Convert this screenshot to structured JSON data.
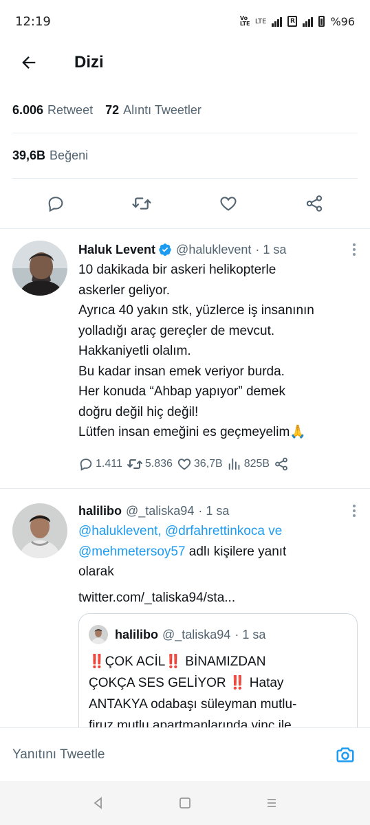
{
  "status_bar": {
    "time": "12:19",
    "volte": "Vo LTE",
    "network": "LTE",
    "battery": "%96"
  },
  "header": {
    "title": "Dizi"
  },
  "stats": {
    "retweet_count": "6.006",
    "retweet_label": "Retweet",
    "quote_count": "72",
    "quote_label": "Alıntı Tweetler",
    "like_count": "39,6B",
    "like_label": "Beğeni"
  },
  "tweets": [
    {
      "name": "Haluk Levent",
      "handle": "@haluklevent",
      "time": "· 1 sa",
      "verified": true,
      "text": "10 dakikada bir askeri helikopterle\naskerler geliyor.\nAyrıca 40 yakın stk, yüzlerce iş insanının\nyolladığı araç gereçler de mevcut.\nHakkaniyetli olalım.\nBu kadar insan emek veriyor burda.\nHer konuda “Ahbap yapıyor” demek\ndoğru değil hiç değil!\nLütfen insan emeğini es geçmeyelim🙏",
      "metrics": {
        "replies": "1.411",
        "retweets": "5.836",
        "likes": "36,7B",
        "views": "825B"
      }
    },
    {
      "name": "halilibo",
      "handle": "@_taliska94",
      "time": "· 1 sa",
      "reply_mentions_1": "@haluklevent, @drfahrettinkoca ve",
      "reply_mentions_2": "@mehmetersoy57",
      "reply_suffix": " adlı kişilere yanıt",
      "reply_suffix_2": "olarak",
      "link": "twitter.com/_taliska94/sta...",
      "quote": {
        "name": "halilibo",
        "handle": "@_taliska94",
        "time": "· 1 sa",
        "bang": "‼️",
        "part1": "ÇOK ACİL",
        "part2": "BİNAMIZDAN",
        "part3": "ÇOKÇA SES GELİYOR ",
        "part4": "Hatay",
        "part5": "ANTAKYA odabaşı süleyman mutlu-",
        "part6": "firuz mutlu apartmanlarında vinç ile"
      }
    }
  ],
  "reply_bar": {
    "placeholder": "Yanıtını Tweetle"
  },
  "colors": {
    "accent": "#1d9bf0",
    "text": "#0f1419",
    "muted": "#536471",
    "border": "#e6ecf0"
  }
}
